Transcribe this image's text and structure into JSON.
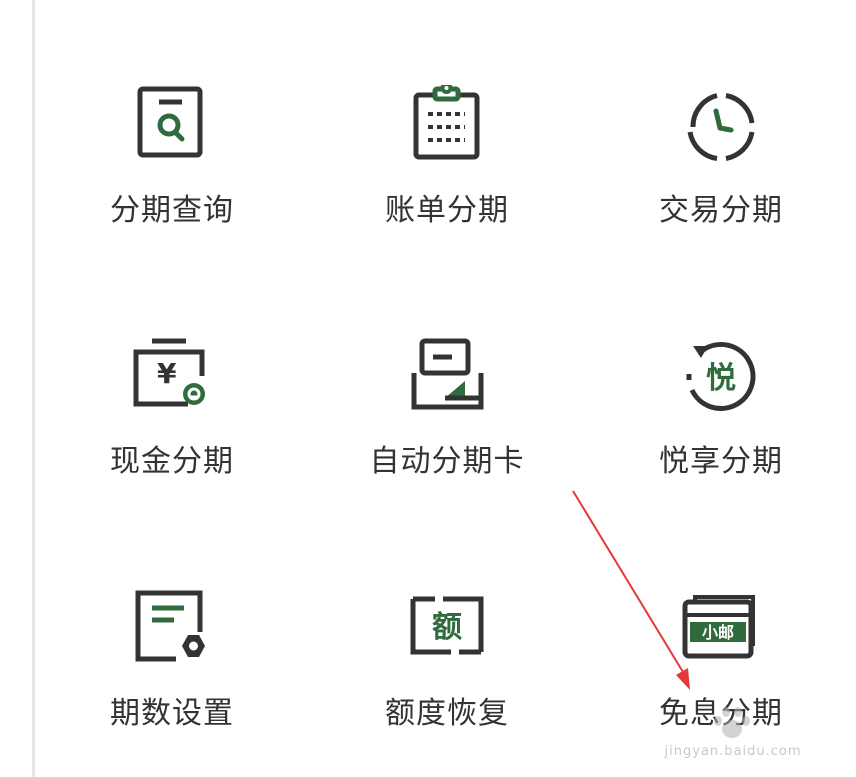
{
  "colors": {
    "icon_dark": "#333333",
    "icon_green": "#2f6b3d",
    "label": "#333333",
    "arrow": "#e53935"
  },
  "menu": {
    "items": [
      {
        "id": "installment-query",
        "label": "分期查询",
        "icon": "document-search-icon"
      },
      {
        "id": "bill-installment",
        "label": "账单分期",
        "icon": "clipboard-icon"
      },
      {
        "id": "transaction-installment",
        "label": "交易分期",
        "icon": "clock-icon"
      },
      {
        "id": "cash-installment",
        "label": "现金分期",
        "icon": "yen-card-icon"
      },
      {
        "id": "auto-installment-card",
        "label": "自动分期卡",
        "icon": "auto-card-icon"
      },
      {
        "id": "yuexiang-installment",
        "label": "悦享分期",
        "icon": "yue-circle-icon",
        "glyph": "悦"
      },
      {
        "id": "period-settings",
        "label": "期数设置",
        "icon": "document-gear-icon"
      },
      {
        "id": "limit-recovery",
        "label": "额度恢复",
        "icon": "limit-frame-icon",
        "glyph": "额"
      },
      {
        "id": "interest-free-installment",
        "label": "免息分期",
        "icon": "xiaoyou-card-icon",
        "glyph": "小邮"
      }
    ]
  },
  "watermark": {
    "text": "jingyan.baidu.com",
    "icon": "baidu-paw-icon"
  }
}
